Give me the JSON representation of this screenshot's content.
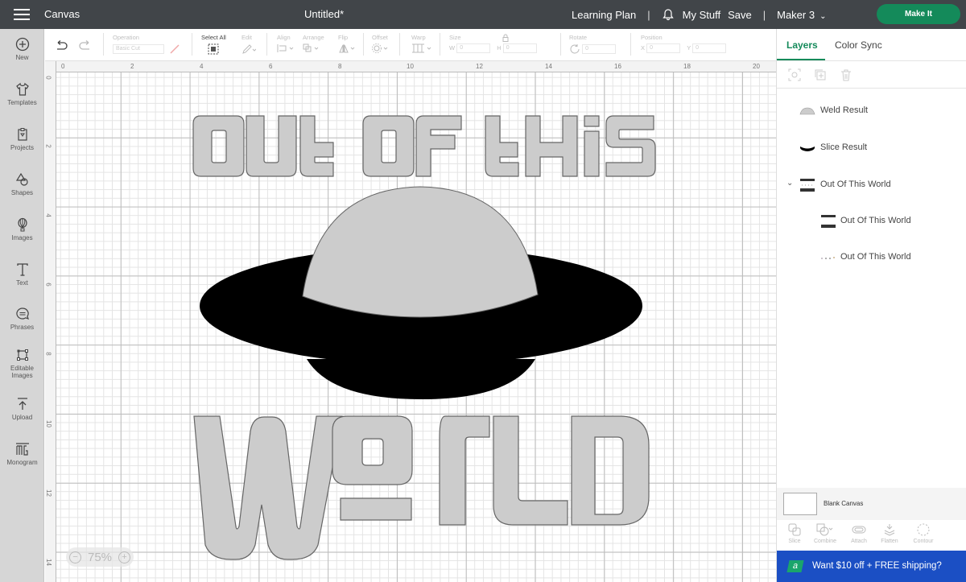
{
  "topbar": {
    "app_section": "Canvas",
    "document_title": "Untitled*",
    "learning_plan": "Learning Plan",
    "separator": "|",
    "my_stuff": "My Stuff",
    "save": "Save",
    "machine": "Maker 3",
    "make_it": "Make It",
    "make_it_color": "#148a5a"
  },
  "leftnav": {
    "items": [
      {
        "label": "New",
        "icon": "plus-circle-icon"
      },
      {
        "label": "Templates",
        "icon": "shirt-icon"
      },
      {
        "label": "Projects",
        "icon": "clipboard-icon"
      },
      {
        "label": "Shapes",
        "icon": "shapes-icon"
      },
      {
        "label": "Images",
        "icon": "balloon-icon"
      },
      {
        "label": "Text",
        "icon": "text-icon"
      },
      {
        "label": "Phrases",
        "icon": "speech-bubble-icon"
      },
      {
        "label": "Editable",
        "label2": "Images",
        "icon": "editable-images-icon"
      },
      {
        "label": "Upload",
        "icon": "upload-icon"
      },
      {
        "label": "Monogram",
        "icon": "monogram-icon"
      }
    ]
  },
  "toolbar": {
    "operation_label": "Operation",
    "operation_value": "Basic Cut",
    "select_all": "Select All",
    "edit": "Edit",
    "align": "Align",
    "arrange": "Arrange",
    "flip": "Flip",
    "offset": "Offset",
    "warp": "Warp",
    "size": "Size",
    "w": "W",
    "h": "H",
    "w_value": "0",
    "h_value": "0",
    "rotate": "Rotate",
    "rotate_value": "0",
    "position": "Position",
    "x": "X",
    "y": "Y",
    "x_value": "0",
    "y_value": "0"
  },
  "canvas": {
    "ruler_h": [
      "0",
      "2",
      "4",
      "6",
      "8",
      "10",
      "12",
      "14",
      "16",
      "18",
      "20"
    ],
    "ruler_v": [
      "0",
      "2",
      "4",
      "6",
      "8",
      "10",
      "12",
      "14"
    ],
    "zoom_level": "75%",
    "design": {
      "line1": "OUT OF THIS",
      "line2": "WORLD",
      "text_fill": "#cccccc",
      "saucer_fill": "#000000"
    }
  },
  "rpanel": {
    "tabs": [
      "Layers",
      "Color Sync"
    ],
    "active_tab": "Layers",
    "layers": [
      {
        "label": "Weld Result",
        "thumb": "weld-thumbnail"
      },
      {
        "label": "Slice Result",
        "thumb": "slice-thumbnail"
      },
      {
        "label": "Out Of This World",
        "thumb": "group-thumbnail",
        "expanded": true
      },
      {
        "label": "Out Of This World",
        "thumb": "text-thumbnail",
        "child": true
      },
      {
        "label": "Out Of This World",
        "thumb": "dots-thumbnail",
        "child": true
      }
    ],
    "blank_canvas": "Blank Canvas",
    "bottom_tools": [
      "Slice",
      "Combine",
      "Attach",
      "Flatten",
      "Contour"
    ],
    "promo_text": "Want $10 off + FREE shipping?",
    "promo_badge": "a",
    "promo_color": "#1b4fc4"
  }
}
